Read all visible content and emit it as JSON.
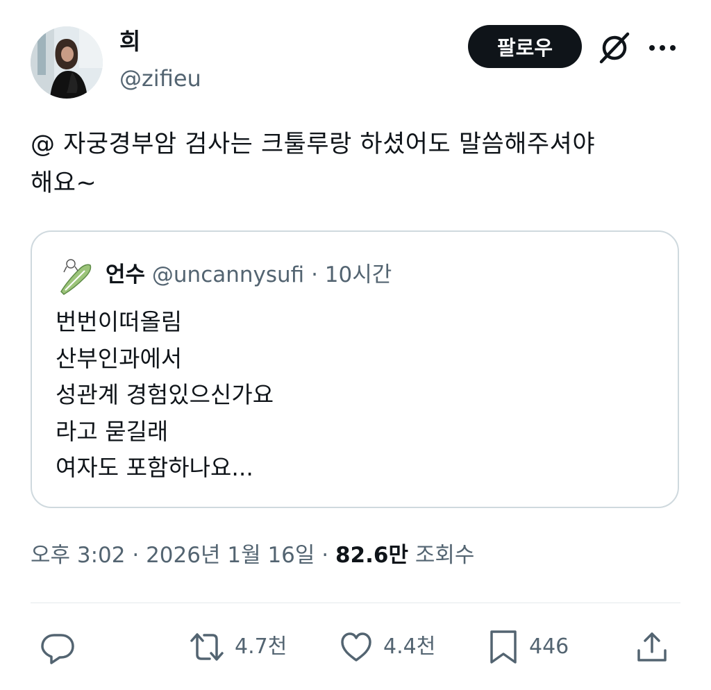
{
  "author": {
    "display_name": "희",
    "handle": "@zifieu"
  },
  "header": {
    "follow_label": "팔로우",
    "grok_icon": "grok-icon",
    "more_icon": "more-horizontal-icon"
  },
  "tweet": {
    "text_line_1": "@ 자궁경부암 검사는 크툴루랑 하셨어도 말씀해주셔야",
    "text_line_2": "해요~"
  },
  "quote": {
    "name": "언수",
    "handle": "@uncannysufi",
    "separator": " · ",
    "time": "10시간",
    "lines": [
      "번번이떠올림",
      "산부인과에서",
      "성관계 경험있으신가요",
      "라고 묻길래",
      "여자도 포함하나요..."
    ]
  },
  "meta": {
    "time": "오후 3:02",
    "sep": " · ",
    "date": "2026년 1월 16일",
    "views_count": "82.6만",
    "views_label": "조회수"
  },
  "actions": {
    "reply_icon": "reply-icon",
    "retweet_count": "4.7천",
    "like_count": "4.4천",
    "bookmark_count": "446",
    "share_icon": "share-icon"
  },
  "colors": {
    "text_primary": "#0f1419",
    "text_secondary": "#536471",
    "border": "#cfd9de",
    "follow_bg": "#0f1419"
  }
}
